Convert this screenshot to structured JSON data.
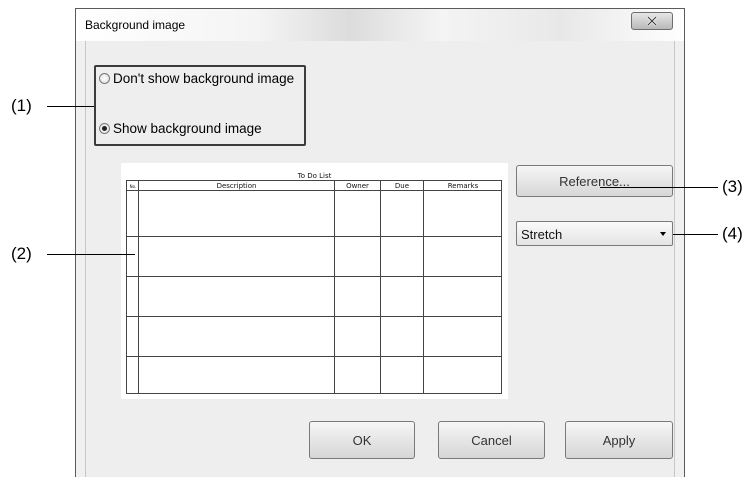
{
  "window": {
    "title": "Background image"
  },
  "radio_group": {
    "options": [
      {
        "label": "Don't show background image",
        "selected": false
      },
      {
        "label": "Show background image",
        "selected": true
      }
    ]
  },
  "preview": {
    "table_title": "To Do List",
    "columns": [
      "No.",
      "Description",
      "Owner",
      "Due",
      "Remarks"
    ]
  },
  "reference_button": "Reference...",
  "display_mode": {
    "selected": "Stretch"
  },
  "footer": {
    "ok": "OK",
    "cancel": "Cancel",
    "apply": "Apply"
  },
  "callouts": [
    "(1)",
    "(2)",
    "(3)",
    "(4)"
  ]
}
